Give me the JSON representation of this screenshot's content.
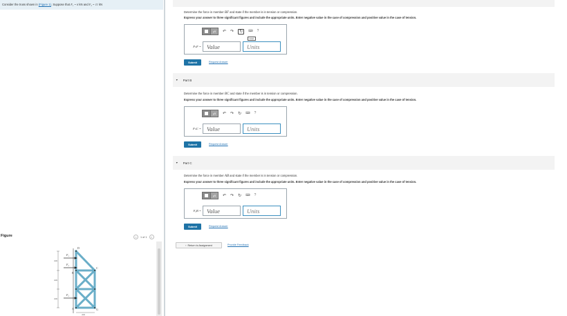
{
  "problem": {
    "prefix": "Consider the truss shown in",
    "link": "(Figure 1)",
    "suffix": ". Suppose that",
    "f1": "F₁ = 6",
    "unit1": "kN",
    "and": "and",
    "f2": "F₂ = 11",
    "unit2": "kN"
  },
  "figure": {
    "title": "Figure",
    "pager": "1 of 1",
    "prev": "<",
    "next": ">",
    "labels": {
      "D": "D",
      "C": "C",
      "B": "B",
      "A": "A",
      "G": "G",
      "F1": "F₁",
      "F2": "F₂"
    },
    "dims": [
      "4 m",
      "4 m",
      "4 m",
      "4 m"
    ]
  },
  "partA": {
    "q1_pre": "Determine the force in member",
    "member": "BF",
    "q1_post": "and state if the member is in tension or compression.",
    "q2": "Express your answer to three significant figures and include the appropriate units. Enter negative value in the case of compression and positive value in the case of tension.",
    "var_label": "FₕF =",
    "value_placeholder": "Value",
    "units_placeholder": "Units",
    "tooltip": "reset",
    "submit": "Submit",
    "request": "Request Answer"
  },
  "partB": {
    "header": "Part B",
    "q1_pre": "Determine the force in member",
    "member": "BC",
    "q1_post": "and state if the member is in tension or compression.",
    "q2": "Express your answer to three significant figures and include the appropriate units. Enter negative value in the case of compression and positive value in the case of tension.",
    "var_label": "FₕC =",
    "value_placeholder": "Value",
    "units_placeholder": "Units",
    "submit": "Submit",
    "request": "Request Answer"
  },
  "partC": {
    "header": "Part C",
    "q1_pre": "Determine the force in member",
    "member": "AB",
    "q1_post": "and state if the member is in tension or compression.",
    "q2": "Express your answer to three significant figures and include the appropriate units. Enter negative value in the case of compression and positive value in the case of tension.",
    "var_label": "FₐB =",
    "value_placeholder": "Value",
    "units_placeholder": "Units",
    "submit": "Submit",
    "request": "Request Answer"
  },
  "toolbar": {
    "mu": "μA",
    "undo": "↶",
    "redo": "↷",
    "reset": "↻",
    "keyboard": "⌨",
    "help": "?"
  },
  "footer": {
    "return": "Return to Assignment",
    "feedback": "Provide Feedback"
  },
  "colors": {
    "accent": "#1e73a6",
    "truss": "#6aaec8",
    "link": "#1f6fb2"
  }
}
